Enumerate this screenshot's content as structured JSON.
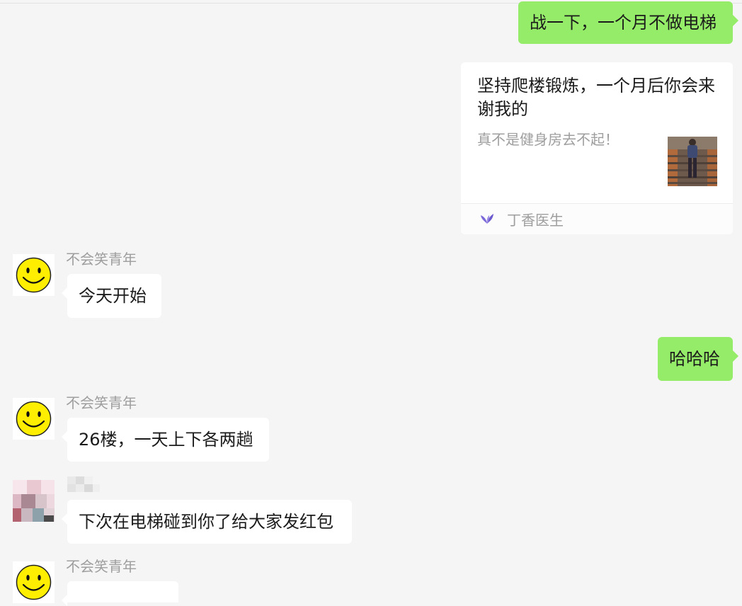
{
  "messages": [
    {
      "type": "text",
      "side": "right",
      "text": "战一下，一个月不做电梯"
    },
    {
      "type": "card",
      "side": "right",
      "title": "坚持爬楼锻炼，一个月后你会来谢我的",
      "description": "真不是健身房去不起！",
      "source": "丁香医生",
      "source_icon": "dxy-icon"
    },
    {
      "type": "text",
      "side": "left",
      "sender": "不会笑青年",
      "avatar": "smiley-icon",
      "text": "今天开始"
    },
    {
      "type": "text",
      "side": "right",
      "text": "哈哈哈"
    },
    {
      "type": "text",
      "side": "left",
      "sender": "不会笑青年",
      "avatar": "smiley-icon",
      "text": "26楼，一天上下各两趟"
    },
    {
      "type": "text",
      "side": "left",
      "sender": "",
      "avatar": "blurred-avatar",
      "text": "下次在电梯碰到你了给大家发红包"
    },
    {
      "type": "text",
      "side": "left",
      "sender": "不会笑青年",
      "avatar": "smiley-icon",
      "text": ""
    }
  ],
  "colors": {
    "background": "#f5f5f5",
    "self_bubble": "#95ec69",
    "other_bubble": "#ffffff",
    "sender_name": "#9e9e9e",
    "card_source_icon": "#7b68d8"
  }
}
